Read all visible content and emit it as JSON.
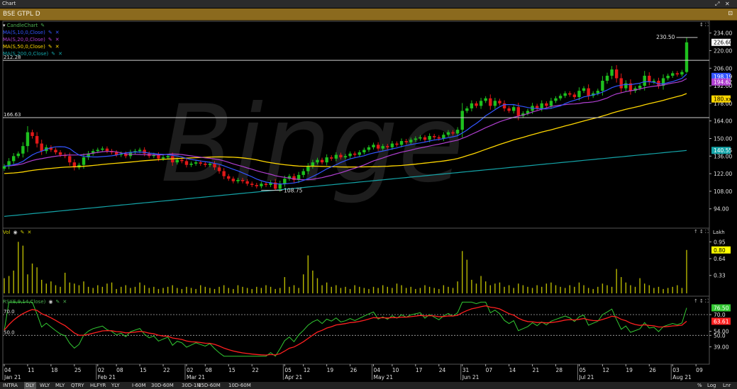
{
  "window": {
    "title": "Chart"
  },
  "symbol_bar": {
    "title": "BSE GTPL D"
  },
  "legend": {
    "price": [
      {
        "label": "CandleChart",
        "color": "#4caf50"
      },
      {
        "label": "MA(S,10,0,Close)",
        "color": "#3355ff"
      },
      {
        "label": "MA(S,20,0,Close)",
        "color": "#b03fd0"
      },
      {
        "label": "MA(S,50,0,Close)",
        "color": "#ffd700"
      },
      {
        "label": "MA(S,200,0,Close)",
        "color": "#14a4a8"
      }
    ],
    "vol": {
      "label": "Vol",
      "color": "#cccc00"
    },
    "rsi": {
      "label": "RSI(E,9,14,Close)",
      "color": "#4caf50"
    },
    "lakh": "Lakh"
  },
  "bottom_tabs": [
    "INTRA",
    "DLY",
    "WLY",
    "MLY",
    "QTRY",
    "HLFYR",
    "YLY",
    "I-60M",
    "30D-60M",
    "30D-1M",
    "15D-60M",
    "10D-60M"
  ],
  "bottom_right": [
    "%",
    "Log",
    "Lnr"
  ],
  "active_tab": "DLY",
  "chart_data": {
    "type": "candlestick",
    "colors": {
      "up": "#1ec01e",
      "down": "#e01818",
      "ma10": "#3355ff",
      "ma20": "#b03fd0",
      "ma50": "#ffd700",
      "ma200": "#14a4a8",
      "vol": "#b8b800",
      "rsi": "#32c832",
      "rsi_sig": "#ff2020"
    },
    "price_axis": {
      "ticks": [
        "234.00",
        "220.00",
        "206.00",
        "192.00",
        "178.00",
        "164.00",
        "150.00",
        "136.00",
        "122.00",
        "108.00",
        "94.00"
      ],
      "range": [
        82,
        240
      ]
    },
    "vol_axis": {
      "unit": "Lakh",
      "ticks": [
        "0.95",
        "0.64",
        "0.33"
      ],
      "range": [
        0,
        1.15
      ]
    },
    "rsi_axis": {
      "ticks": [
        "70.0",
        "54.00",
        "50.0",
        "39.00"
      ],
      "range": [
        25,
        85
      ]
    },
    "x_labels": [
      {
        "label": "04",
        "sub": "Jan 21",
        "i": 0
      },
      {
        "label": "11",
        "i": 5
      },
      {
        "label": "18",
        "i": 10
      },
      {
        "label": "25",
        "i": 15
      },
      {
        "label": "02",
        "sub": "Feb 21",
        "i": 20
      },
      {
        "label": "08",
        "i": 24
      },
      {
        "label": "15",
        "i": 29
      },
      {
        "label": "22",
        "i": 34
      },
      {
        "label": "02",
        "sub": "Mar 21",
        "i": 39
      },
      {
        "label": "08",
        "i": 43
      },
      {
        "label": "15",
        "i": 48
      },
      {
        "label": "22",
        "i": 53
      },
      {
        "label": "05",
        "sub": "Apr 21",
        "i": 60
      },
      {
        "label": "12",
        "i": 64
      },
      {
        "label": "19",
        "i": 69
      },
      {
        "label": "26",
        "i": 74
      },
      {
        "label": "04",
        "sub": "May 21",
        "i": 79
      },
      {
        "label": "10",
        "i": 83
      },
      {
        "label": "17",
        "i": 88
      },
      {
        "label": "24",
        "i": 93
      },
      {
        "label": "31",
        "sub": "Jun 21",
        "i": 98
      },
      {
        "label": "07",
        "i": 103
      },
      {
        "label": "14",
        "i": 108
      },
      {
        "label": "21",
        "i": 113
      },
      {
        "label": "28",
        "i": 118
      },
      {
        "label": "05",
        "sub": "Jul 21",
        "i": 123
      },
      {
        "label": "12",
        "i": 128
      },
      {
        "label": "19",
        "i": 133
      },
      {
        "label": "26",
        "i": 138
      },
      {
        "label": "03",
        "sub": "Aug 21",
        "i": 143
      },
      {
        "label": "09",
        "i": 148
      }
    ],
    "hlines": [
      {
        "value": 212.28,
        "label": "212.28"
      },
      {
        "value": 166.63,
        "label": "166.63"
      }
    ],
    "annotations": [
      {
        "text": "230.50",
        "value": 230.5,
        "i": 145
      },
      {
        "text": "108.75",
        "value": 108.75,
        "i": 58
      }
    ],
    "axis_badges": [
      {
        "text": "226.60",
        "value": 226.6,
        "bg": "#ffffff",
        "fg": "#000000"
      },
      {
        "text": "198.19",
        "value": 199.5,
        "bg": "#3355ff",
        "fg": "#ffffff"
      },
      {
        "text": "194.62",
        "value": 195.0,
        "bg": "#b03fd0",
        "fg": "#ffffff"
      },
      {
        "text": "180.xx",
        "value": 181.5,
        "bg": "#ffd700",
        "fg": "#000000"
      },
      {
        "text": "140.55",
        "value": 140.55,
        "bg": "#14a4a8",
        "fg": "#ffffff"
      },
      {
        "text": "0.80",
        "value": 0.8,
        "bg": "#ffff00",
        "fg": "#000000",
        "pane": "vol"
      },
      {
        "text": "76.50",
        "value": 76.5,
        "bg": "#32c832",
        "fg": "#ffffff",
        "pane": "rsi"
      },
      {
        "text": "63.61",
        "value": 63.6,
        "bg": "#ff2020",
        "fg": "#ffffff",
        "pane": "rsi"
      }
    ],
    "watermark": "Binge",
    "close": [
      128,
      132,
      136,
      138,
      144,
      155,
      152,
      146,
      140,
      143,
      141,
      139,
      137,
      136,
      131,
      127,
      129,
      135,
      138,
      140,
      141,
      142,
      140,
      139,
      137,
      138,
      136,
      139,
      140,
      141,
      138,
      136,
      137,
      134,
      135,
      136,
      131,
      133,
      132,
      129,
      130,
      131,
      130,
      129,
      130,
      127,
      124,
      120,
      118,
      116,
      117,
      116,
      114,
      113,
      112,
      114,
      113,
      115,
      110,
      114,
      118,
      120,
      117,
      121,
      124,
      128,
      131,
      133,
      131,
      135,
      134,
      137,
      135,
      136,
      138,
      137,
      139,
      141,
      143,
      145,
      142,
      144,
      143,
      146,
      145,
      148,
      147,
      149,
      150,
      151,
      149,
      152,
      151,
      150,
      153,
      155,
      154,
      157,
      172,
      174,
      178,
      176,
      180,
      182,
      176,
      180,
      178,
      174,
      172,
      175,
      168,
      170,
      172,
      176,
      174,
      178,
      176,
      180,
      182,
      184,
      186,
      185,
      183,
      188,
      190,
      184,
      186,
      188,
      196,
      200,
      205,
      198,
      190,
      194,
      188,
      190,
      192,
      200,
      195,
      196,
      192,
      198,
      200,
      202,
      201,
      203,
      226.6
    ],
    "volume": [
      0.28,
      0.32,
      0.42,
      0.95,
      0.88,
      0.35,
      0.55,
      0.48,
      0.25,
      0.18,
      0.22,
      0.15,
      0.12,
      0.38,
      0.2,
      0.18,
      0.15,
      0.22,
      0.12,
      0.1,
      0.15,
      0.12,
      0.18,
      0.2,
      0.08,
      0.12,
      0.15,
      0.1,
      0.12,
      0.2,
      0.15,
      0.1,
      0.12,
      0.08,
      0.1,
      0.12,
      0.15,
      0.1,
      0.08,
      0.12,
      0.1,
      0.08,
      0.15,
      0.12,
      0.1,
      0.08,
      0.12,
      0.15,
      0.1,
      0.08,
      0.15,
      0.12,
      0.1,
      0.08,
      0.12,
      0.1,
      0.15,
      0.12,
      0.08,
      0.1,
      0.3,
      0.12,
      0.15,
      0.1,
      0.35,
      0.7,
      0.42,
      0.28,
      0.15,
      0.2,
      0.12,
      0.15,
      0.1,
      0.12,
      0.08,
      0.15,
      0.12,
      0.1,
      0.08,
      0.12,
      0.1,
      0.15,
      0.12,
      0.1,
      0.18,
      0.15,
      0.1,
      0.12,
      0.08,
      0.1,
      0.15,
      0.12,
      0.1,
      0.08,
      0.15,
      0.12,
      0.1,
      0.22,
      0.78,
      0.62,
      0.25,
      0.18,
      0.32,
      0.22,
      0.15,
      0.18,
      0.2,
      0.12,
      0.15,
      0.1,
      0.18,
      0.15,
      0.12,
      0.1,
      0.15,
      0.12,
      0.18,
      0.2,
      0.15,
      0.12,
      0.1,
      0.15,
      0.12,
      0.2,
      0.15,
      0.1,
      0.08,
      0.12,
      0.18,
      0.15,
      0.12,
      0.45,
      0.3,
      0.2,
      0.15,
      0.12,
      0.28,
      0.18,
      0.15,
      0.1,
      0.12,
      0.08,
      0.1,
      0.12,
      0.15,
      0.1,
      0.8
    ]
  }
}
